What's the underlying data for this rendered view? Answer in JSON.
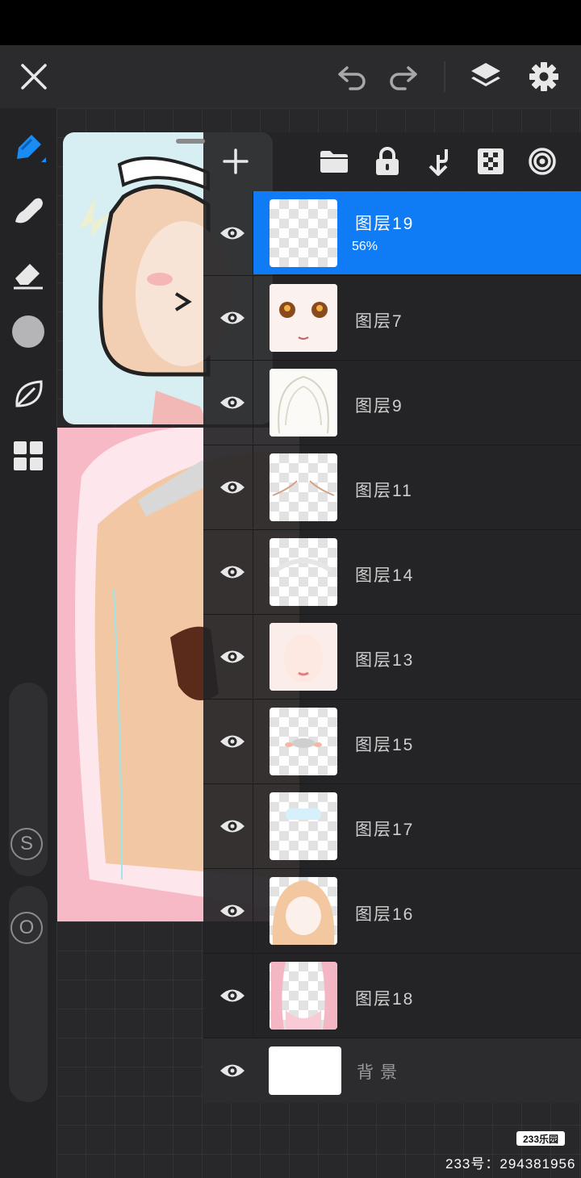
{
  "layers": [
    {
      "name": "图层19",
      "opacity": "56%",
      "selected": true
    },
    {
      "name": "图层7",
      "opacity": "",
      "selected": false
    },
    {
      "name": "图层9",
      "opacity": "",
      "selected": false
    },
    {
      "name": "图层11",
      "opacity": "",
      "selected": false
    },
    {
      "name": "图层14",
      "opacity": "",
      "selected": false
    },
    {
      "name": "图层13",
      "opacity": "",
      "selected": false
    },
    {
      "name": "图层15",
      "opacity": "",
      "selected": false
    },
    {
      "name": "图层17",
      "opacity": "",
      "selected": false
    },
    {
      "name": "图层16",
      "opacity": "",
      "selected": false
    },
    {
      "name": "图层18",
      "opacity": "",
      "selected": false
    }
  ],
  "background_layer": {
    "name": "背景"
  },
  "sidebar": {
    "size_label": "S",
    "opacity_label": "O"
  },
  "watermark": {
    "logo": "233乐园",
    "text": "233号：294381956"
  },
  "colors": {
    "accent": "#0f7cf5",
    "brush_color": "#b5b5b7",
    "background": "#232325"
  }
}
